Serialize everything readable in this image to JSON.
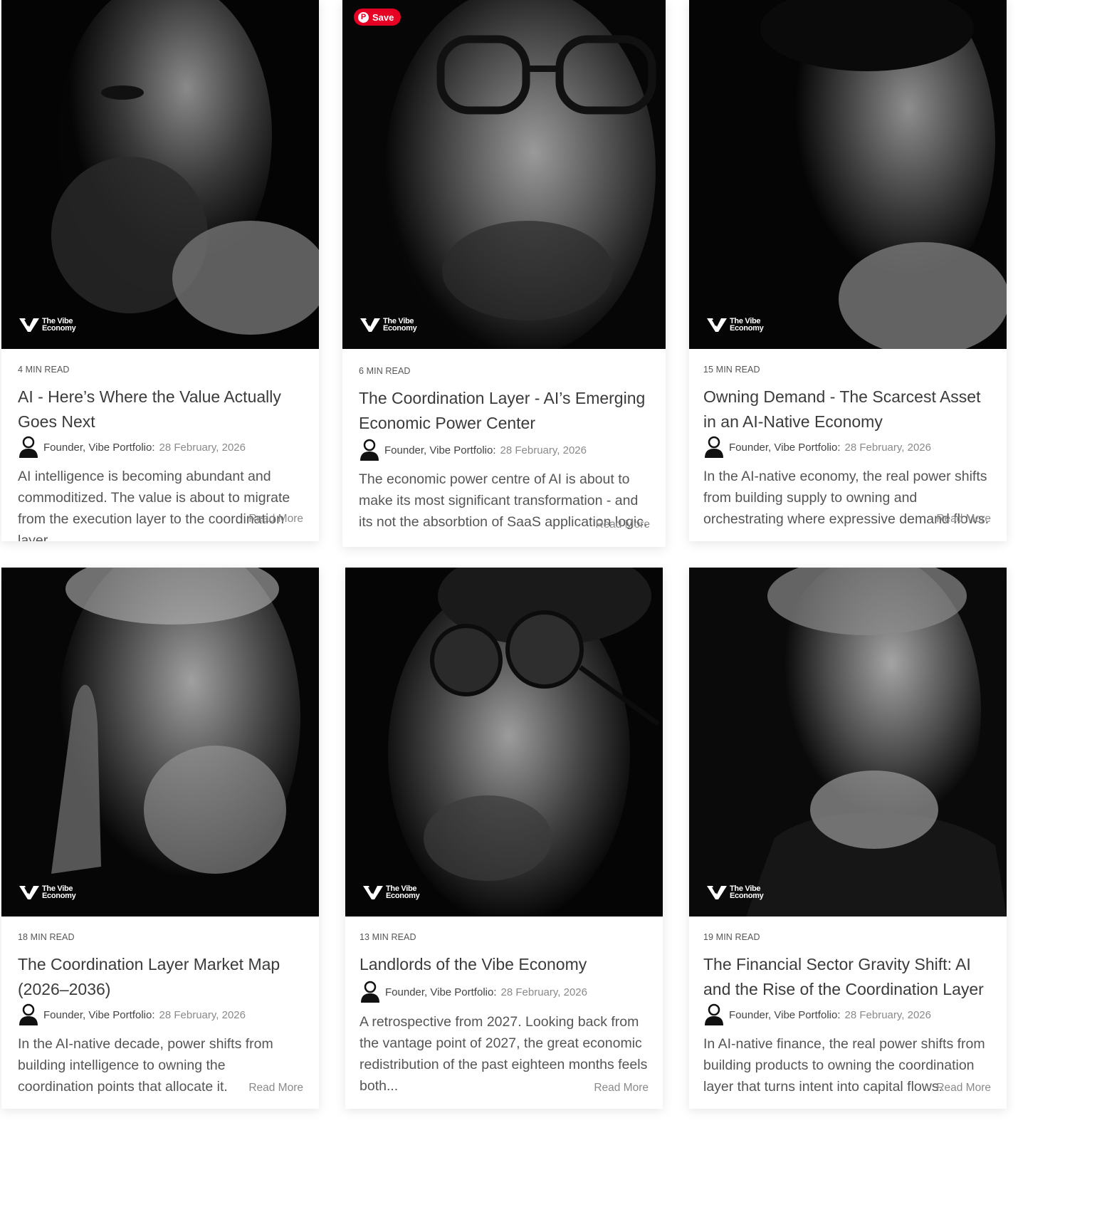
{
  "brand": {
    "line1": "The Vibe",
    "line2": "Economy"
  },
  "pin_save_label": "Save",
  "read_more_label": "Read More",
  "author_label": "Founder, Vibe Portfolio:",
  "posts": [
    {
      "read_time": "4 MIN READ",
      "title": "AI - Here’s Where the Value Actually Goes Next",
      "date": "28 February, 2026",
      "excerpt": "AI intelligence is becoming abundant and commoditized. The value is about to migrate from the execution layer to the coordination layer.",
      "image_alt": "Bearded older man portrait, hand on chin"
    },
    {
      "read_time": "6 MIN READ",
      "title": "The Coordination Layer - AI’s Emerging Economic Power Center",
      "date": "28 February, 2026",
      "excerpt": "The economic power centre of AI is about to make its most significant transformation - and its not the absorbtion of SaaS application logic.",
      "image_alt": "Man with glasses close-up portrait"
    },
    {
      "read_time": "15 MIN READ",
      "title": "Owning Demand - The Scarcest Asset in an AI-Native Economy",
      "date": "28 February, 2026",
      "excerpt": "In the AI-native economy, the real power shifts from building supply to owning and orchestrating where expressive demand flows.",
      "image_alt": "Young man portrait, hand at chin"
    },
    {
      "read_time": "18 MIN READ",
      "title": "The Coordination Layer Market Map (2026–2036)",
      "date": "28 February, 2026",
      "excerpt": "In the AI-native decade, power shifts from building intelligence to owning the coordination points that allocate it.",
      "image_alt": "Older man portrait, finger at temple"
    },
    {
      "read_time": "13 MIN READ",
      "title": "Landlords of the Vibe Economy",
      "date": "28 February, 2026",
      "excerpt": "A retrospective from 2027. Looking back from the vantage point of 2027, the great economic redistribution of the past eighteen months feels both...",
      "image_alt": "Man with round sunglasses looking up"
    },
    {
      "read_time": "19 MIN READ",
      "title": "The Financial Sector Gravity Shift: AI and the Rise of the Coordination Layer",
      "date": "28 February, 2026",
      "excerpt": "In AI-native finance, the real power shifts from building products to owning the coordination layer that turns intent into capital flows.",
      "image_alt": "Grey-haired man in suit, hand at chin"
    }
  ]
}
